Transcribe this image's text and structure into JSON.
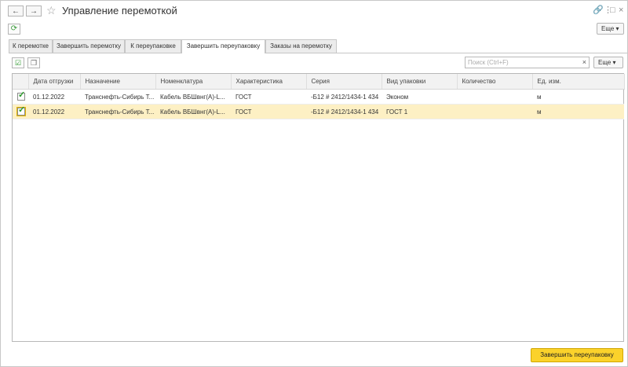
{
  "window": {
    "title": "Управление перемоткой",
    "back_icon": "arrow-left-icon",
    "forward_icon": "arrow-right-icon",
    "star_icon": "star-icon"
  },
  "toolbar": {
    "refresh_icon": "refresh-icon",
    "more_label": "Еще"
  },
  "tabs": [
    {
      "label": "К перемотке",
      "active": false
    },
    {
      "label": "Завершить перемотку",
      "active": false
    },
    {
      "label": "К переупаковке",
      "active": false
    },
    {
      "label": "Завершить переупаковку",
      "active": true
    },
    {
      "label": "Заказы на перемотку",
      "active": false
    }
  ],
  "list": {
    "search_placeholder": "Поиск (Ctrl+F)",
    "search_value": "",
    "more_label": "Еще",
    "columns": [
      "Дата отгрузки",
      "Назначение",
      "Номенклатура",
      "Характеристика",
      "Серия",
      "Вид упаковки",
      "Количество",
      "Ед. изм."
    ],
    "rows": [
      {
        "checked": true,
        "date": "01.12.2022",
        "purpose": "Транснефть-Сибирь Т...",
        "item": "Кабель ВБШвнг(А)-L...",
        "characteristic": "ГОСТ",
        "series": "-Б12 # 2412/1434-1 434",
        "package": "Эконом",
        "quantity": "",
        "unit": "м",
        "selected": false
      },
      {
        "checked": true,
        "date": "01.12.2022",
        "purpose": "Транснефть-Сибирь Т...",
        "item": "Кабель ВБШвнг(А)-L...",
        "characteristic": "ГОСТ",
        "series": "-Б12 # 2412/1434-1 434",
        "package": "ГОСТ 1",
        "quantity": "",
        "unit": "м",
        "selected": true
      }
    ]
  },
  "footer": {
    "finish_label": "Завершить переупаковку"
  },
  "colors": {
    "accent": "#fbd22b",
    "selected_row": "#fdf0c4",
    "check": "#2a9a2a"
  }
}
